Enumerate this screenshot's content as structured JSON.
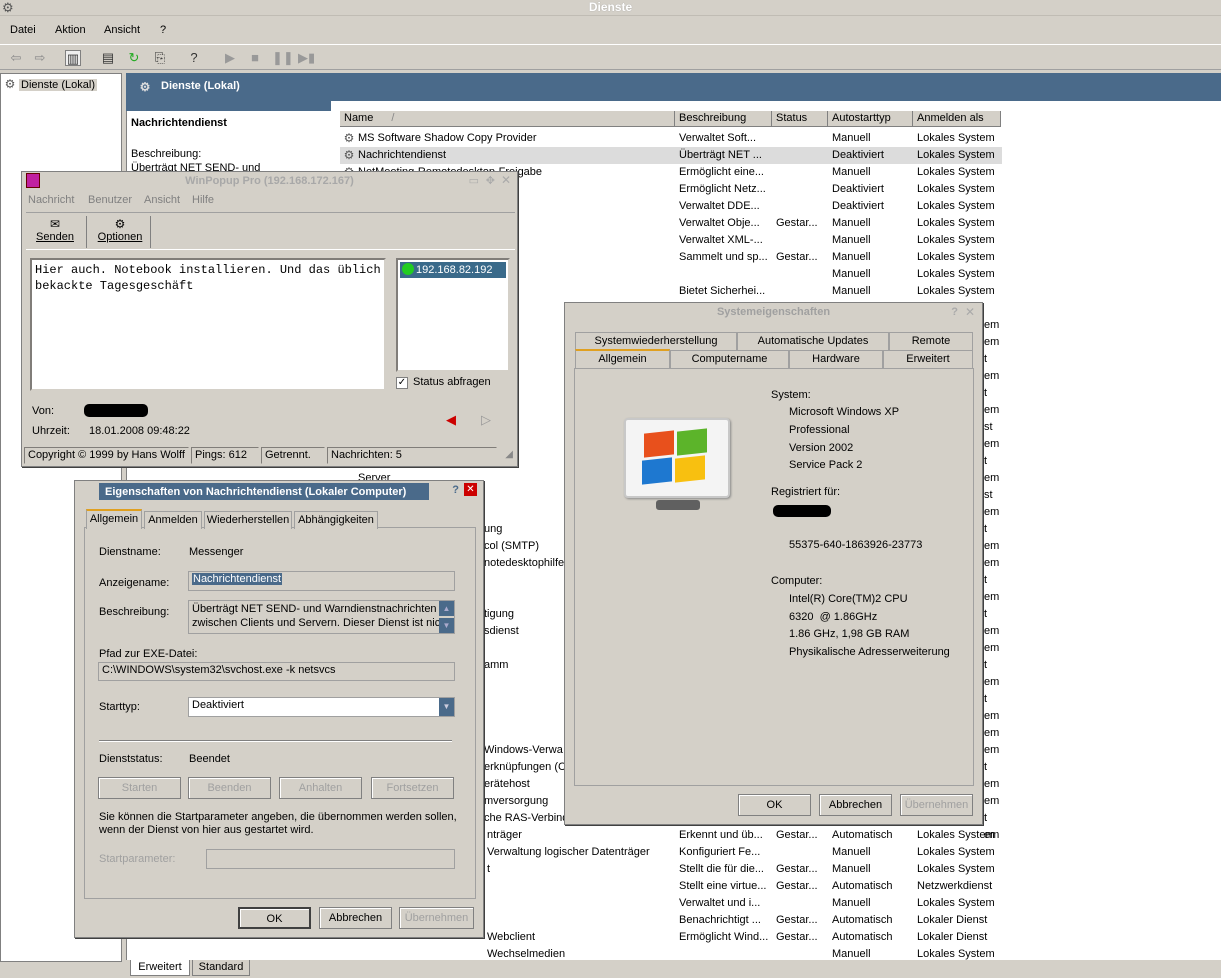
{
  "app": {
    "title": "Dienste"
  },
  "menu": [
    "Datei",
    "Aktion",
    "Ansicht",
    "?"
  ],
  "tree": {
    "root": "Dienste (Lokal)"
  },
  "header": {
    "title": "Dienste (Lokal)"
  },
  "detail": {
    "title": "Nachrichtendienst",
    "desc_label": "Beschreibung:",
    "desc_text": "Überträgt NET SEND- und"
  },
  "columns": [
    "Name",
    "Beschreibung",
    "Status",
    "Autostarttyp",
    "Anmelden als"
  ],
  "rows": [
    {
      "name": "MS Software Shadow Copy Provider",
      "desc": "Verwaltet Soft...",
      "status": "",
      "start": "Manuell",
      "logon": "Lokales System"
    },
    {
      "name": "Nachrichtendienst",
      "desc": "Überträgt NET ...",
      "status": "",
      "start": "Deaktiviert",
      "logon": "Lokales System"
    },
    {
      "name": "NetMeeting-Remotedesktop-Freigabe",
      "desc": "Ermöglicht eine...",
      "status": "",
      "start": "Manuell",
      "logon": "Lokales System"
    },
    {
      "name": "",
      "desc": "Ermöglicht Netz...",
      "status": "",
      "start": "Deaktiviert",
      "logon": "Lokales System"
    },
    {
      "name": "",
      "desc": "Verwaltet  DDE...",
      "status": "",
      "start": "Deaktiviert",
      "logon": "Lokales System"
    },
    {
      "name": "",
      "desc": "Verwaltet Obje...",
      "status": "Gestar...",
      "start": "Manuell",
      "logon": "Lokales System"
    },
    {
      "name": "",
      "desc": "Verwaltet XML-...",
      "status": "",
      "start": "Manuell",
      "logon": "Lokales System"
    },
    {
      "name": "ss)",
      "desc": "Sammelt und sp...",
      "status": "Gestar...",
      "start": "Manuell",
      "logon": "Lokales System"
    },
    {
      "name": "",
      "desc": "",
      "status": "",
      "start": "Manuell",
      "logon": "Lokales System"
    },
    {
      "name": "",
      "desc": "Bietet Sicherhei...",
      "status": "",
      "start": "Manuell",
      "logon": "Lokales System"
    }
  ],
  "partial_rows": [
    {
      "name": "Server"
    },
    {
      "name": "ung"
    },
    {
      "name": "col (SMTP)"
    },
    {
      "name": "notedesktophilfe"
    },
    {
      "name": "tigung"
    },
    {
      "name": "sdienst"
    },
    {
      "name": "amm"
    },
    {
      "name": "Windows-Verwa"
    },
    {
      "name": "erknüpfungen (C"
    },
    {
      "name": "erätehost"
    },
    {
      "name": "mversorgung"
    },
    {
      "name": "che RAS-Verbind"
    }
  ],
  "right_edge": [
    "em",
    "em",
    "t",
    "em",
    "t",
    "em",
    "st",
    "em",
    "t",
    "em",
    "st",
    "em",
    "t",
    "em",
    "em",
    "t",
    "em",
    "t",
    "em",
    "em",
    "t",
    "em",
    "t",
    "em",
    "em",
    "em",
    "t",
    "em",
    "em",
    "t",
    "em"
  ],
  "bottom_rows": [
    {
      "name": "nträger",
      "desc": "Erkennt und üb...",
      "status": "Gestar...",
      "start": "Automatisch",
      "logon": "Lokales System"
    },
    {
      "name": "Verwaltung logischer Datenträger",
      "desc": "Konfiguriert Fe...",
      "status": "",
      "start": "Manuell",
      "logon": "Lokales System"
    },
    {
      "name": "t",
      "desc": "Stellt die für die...",
      "status": "Gestar...",
      "start": "Manuell",
      "logon": "Lokales System"
    },
    {
      "name": "",
      "desc": "Stellt eine virtue...",
      "status": "Gestar...",
      "start": "Automatisch",
      "logon": "Netzwerkdienst"
    },
    {
      "name": "",
      "desc": "Verwaltet und i...",
      "status": "",
      "start": "Manuell",
      "logon": "Lokales System"
    },
    {
      "name": "",
      "desc": "Benachrichtigt ...",
      "status": "Gestar...",
      "start": "Automatisch",
      "logon": "Lokaler Dienst"
    },
    {
      "name": "Webclient",
      "desc": "Ermöglicht Wind...",
      "status": "Gestar...",
      "start": "Automatisch",
      "logon": "Lokaler Dienst"
    },
    {
      "name": "Wechselmedien",
      "desc": "",
      "status": "",
      "start": "Manuell",
      "logon": "Lokales System"
    }
  ],
  "bottom_tabs": [
    "Erweitert",
    "Standard"
  ],
  "winpopup": {
    "title": "WinPopup Pro (192.168.172.167)",
    "menu": [
      "Nachricht",
      "Benutzer",
      "Ansicht",
      "Hilfe"
    ],
    "send": "Senden",
    "options": "Optionen",
    "message": "Hier auch. Notebook installieren. Und das üblich bekackte Tagesgeschäft",
    "contact": "192.168.82.192",
    "status_check": "Status abfragen",
    "from_label": "Von:",
    "time_label": "Uhrzeit:",
    "time_value": "18.01.2008 09:48:22",
    "status": [
      "Copyright © 1999 by Hans Wolff",
      "Pings: 612",
      "Getrennt.",
      "Nachrichten: 5"
    ]
  },
  "props": {
    "title": "Eigenschaften von Nachrichtendienst (Lokaler Computer)",
    "tabs": [
      "Allgemein",
      "Anmelden",
      "Wiederherstellen",
      "Abhängigkeiten"
    ],
    "service_name_label": "Dienstname:",
    "service_name": "Messenger",
    "display_name_label": "Anzeigename:",
    "display_name": "Nachrichtendienst",
    "desc_label": "Beschreibung:",
    "desc_line1": "Überträgt NET SEND- und Warndienstnachrichten",
    "desc_line2": "zwischen Clients und Servern. Dieser Dienst ist nicht",
    "path_label": "Pfad zur EXE-Datei:",
    "path": "C:\\WINDOWS\\system32\\svchost.exe -k netsvcs",
    "starttype_label": "Starttyp:",
    "starttype": "Deaktiviert",
    "status_label": "Dienststatus:",
    "status": "Beendet",
    "buttons": [
      "Starten",
      "Beenden",
      "Anhalten",
      "Fortsetzen"
    ],
    "hint_line1": "Sie können die Startparameter angeben, die übernommen werden sollen,",
    "hint_line2": "wenn der Dienst von hier aus gestartet wird.",
    "params_label": "Startparameter:",
    "ok": "OK",
    "cancel": "Abbrechen",
    "apply": "Übernehmen"
  },
  "sysprops": {
    "title": "Systemeigenschaften",
    "tabs_top": [
      "Systemwiederherstellung",
      "Automatische Updates",
      "Remote"
    ],
    "tabs_bottom": [
      "Allgemein",
      "Computername",
      "Hardware",
      "Erweitert"
    ],
    "system_label": "System:",
    "system_lines": [
      "Microsoft Windows XP",
      "Professional",
      "Version 2002",
      "Service Pack 2"
    ],
    "registered_label": "Registriert für:",
    "product_id": "55375-640-1863926-23773",
    "computer_label": "Computer:",
    "computer_lines": [
      "Intel(R) Core(TM)2 CPU",
      "6320  @ 1.86GHz",
      "1.86 GHz, 1,98 GB RAM",
      "Physikalische Adresserweiterung"
    ],
    "ok": "OK",
    "cancel": "Abbrechen",
    "apply": "Übernehmen"
  }
}
